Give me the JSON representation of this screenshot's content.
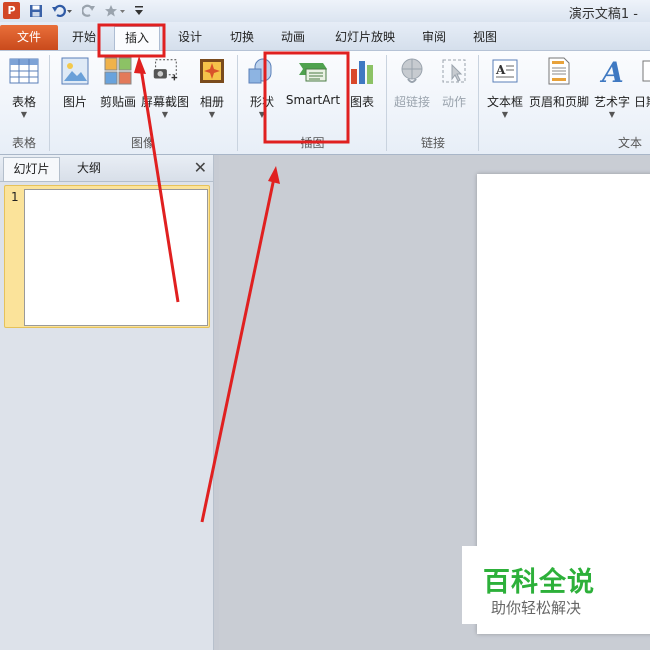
{
  "titlebar": {
    "app_icon_letter": "P",
    "doc_title": "演示文稿1 -"
  },
  "tabs": [
    "文件",
    "开始",
    "插入",
    "设计",
    "切换",
    "动画",
    "幻灯片放映",
    "审阅",
    "视图"
  ],
  "ribbon": {
    "table_btn": "表格",
    "picture_btn": "图片",
    "clipart_btn": "剪贴画",
    "screenshot_btn": "屏幕截图",
    "album_btn": "相册",
    "shapes_btn": "形状",
    "smartart_btn": "SmartArt",
    "chart_btn": "图表",
    "hyperlink_btn": "超链接",
    "action_btn": "动作",
    "textbox_btn": "文本框",
    "header_footer_btn": "页眉和页脚",
    "wordart_btn": "艺术字",
    "date_btn": "日期",
    "groups": {
      "tables": "表格",
      "images": "图像",
      "illustrations": "插图",
      "links": "链接",
      "text": "文本"
    }
  },
  "panel": {
    "tab_slides": "幻灯片",
    "tab_outline": "大纲",
    "close_glyph": "✕",
    "slide_number": "1"
  },
  "watermark": {
    "title": "百科全说",
    "subtitle": "助你轻松解决"
  },
  "colors": {
    "file_tab": "#d24726",
    "annotation_red": "#e02020",
    "watermark_green": "#2db03a"
  }
}
